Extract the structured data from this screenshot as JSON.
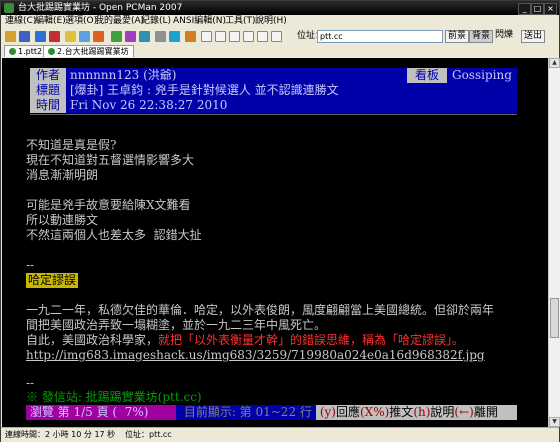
{
  "window": {
    "title": "台大批踢踢實業坊 - Open PCMan 2007"
  },
  "menu": [
    "連線(C)",
    "編輯(E)",
    "選項(O)",
    "我的最愛(A)",
    "紀錄(L)",
    "ANSI編輯(N)",
    "工具(T)",
    "說明(H)"
  ],
  "toolbar": {
    "address_label": "位址：",
    "address_value": "ptt.cc",
    "btn_fg": "前景",
    "btn_bg": "背景",
    "btn_flash": "閃爍",
    "btn_send": "送出"
  },
  "tabs": [
    {
      "label": "1.ptt2"
    },
    {
      "label": "2.台大批踢踢實業坊"
    }
  ],
  "post": {
    "author_key": "作者",
    "author_val": "nnnnnn123 (洪爺)",
    "board_key": "看板",
    "board_val": "Gossiping",
    "title_key": "標題",
    "title_val": "[爆卦] 王卓鈞 : 兇手是針對候選人 並不認識連勝文",
    "time_key": "時間",
    "time_val": "Fri Nov 26 22:38:27 2010",
    "lines": [
      "不知道是真是假?",
      "現在不知道對五督選情影響多大",
      "消息漸漸明朗",
      "",
      "可能是兇手故意要給陳X文難看",
      "所以動連勝文",
      "不然這兩個人也差太多  認錯大扯"
    ],
    "sep1": "--",
    "tag": "哈定謬誤",
    "para1": "一九二一年，私德欠佳的華倫．哈定，以外表俊朗，風度翩翩當上美國總統。但卻於兩年",
    "para2": "間把美國政治弄致一塌糊塗，並於一九二三年中風死亡。",
    "para3_a": "自此，美國政治科學家，",
    "para3_b": "就把「以外表衡量才幹」的錯誤思維，稱為「哈定謬誤」。",
    "url": "http://img683.imageshack.us/img683/3259/719980a024e0a16d968382f.jpg",
    "sep2": "--",
    "source": "※ 發信站: 批踢踢實業坊(ptt.cc)"
  },
  "footer": {
    "browse": " 瀏覽 第 1/5 頁 (  7%) ",
    "lines": " 目前顯示: 第 01~22 行 ",
    "help_a": " (y)",
    "help_b": "回應",
    "help_c": "(X%)",
    "help_d": "推文",
    "help_e": "(h)",
    "help_f": "說明",
    "help_g": "(←)",
    "help_h": "離開"
  },
  "status": {
    "connected": "連線時間：2 小時 10 分 17 秒",
    "site": "位址：ptt.cc"
  },
  "colors": {
    "header_blue": "#0000a8",
    "tag_yellow": "#c8b800",
    "red_text": "#ff3030",
    "source_green": "#00a000",
    "footer_magenta": "#a000a0"
  }
}
